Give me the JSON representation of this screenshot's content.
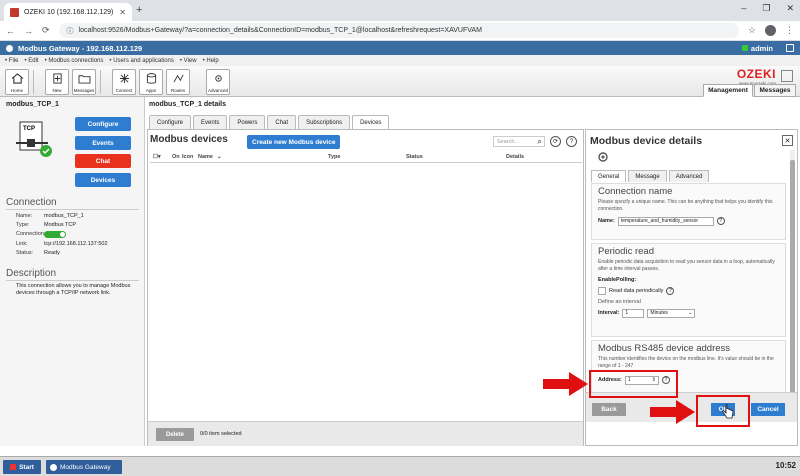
{
  "browser": {
    "tab_title": "OZEKI 10 (192.168.112.129)",
    "url": "localhost:9526/Modbus+Gateway/?a=connection_details&ConnectionID=modbus_TCP_1@localhost&refreshrequest=XAVUFVAM"
  },
  "app": {
    "title": "Modbus Gateway - 192.168.112.129",
    "user": "admin",
    "menu": [
      "File",
      "Edit",
      "Modbus connections",
      "Users and applications",
      "View",
      "Help"
    ],
    "toolbar": [
      "Home",
      "New",
      "Messages",
      "Connect",
      "Apps",
      "Routes",
      "Advanced"
    ],
    "brand": "OZEKI",
    "brand_sub": "www.myozeki.com",
    "right_tabs": [
      "Management",
      "Messages"
    ]
  },
  "left": {
    "title": "modbus_TCP_1",
    "buttons": [
      "Configure",
      "Events",
      "Chat",
      "Devices"
    ],
    "connection_title": "Connection",
    "props": [
      {
        "k": "Name:",
        "v": "modbus_TCP_1"
      },
      {
        "k": "Type:",
        "v": "Modbus TCP"
      },
      {
        "k": "Connection:",
        "v": ""
      },
      {
        "k": "Link:",
        "v": "tcp://192.168.112.137:502"
      },
      {
        "k": "Status:",
        "v": "Ready"
      }
    ],
    "description_title": "Description",
    "description": "This connection allows you to manage Modbus devices through a TCP/IP network link."
  },
  "main": {
    "title": "modbus_TCP_1 details",
    "tabs": [
      "Configure",
      "Events",
      "Powers",
      "Chat",
      "Subscriptions",
      "Devices"
    ],
    "heading": "Modbus devices",
    "new_button": "Create new Modbus device",
    "search_placeholder": "Search...",
    "columns": [
      "On",
      "Icon",
      "Name",
      "Type",
      "Status",
      "Details"
    ],
    "delete": "Delete",
    "selection": "0/0 item selected"
  },
  "details": {
    "title": "Modbus device details",
    "tabs": [
      "General",
      "Message",
      "Advanced"
    ],
    "conn_title": "Connection name",
    "conn_desc": "Please specify a unique name. This can be anything that helps you identify this connection.",
    "name_label": "Name:",
    "name_value": "temperature_and_humidity_sensor",
    "periodic_title": "Periodic read",
    "periodic_desc": "Enable periodic data acquisition to read you sensor data in a loop, automatically after a time interval passes.",
    "enable_label": "EnablePolling:",
    "checkbox_label": "Read data periodically",
    "interval_hint": "Define an interval",
    "interval_label": "Interval:",
    "interval_value": "1",
    "interval_unit": "Minutes",
    "address_title": "Modbus RS485 device address",
    "address_desc": "This number identifies the device on the modbus line. It's value should be in the range of 1 - 247",
    "address_label": "Address:",
    "address_value": "1",
    "back": "Back",
    "ok": "Ok",
    "cancel": "Cancel"
  },
  "taskbar": {
    "start": "Start",
    "item": "Modbus Gateway",
    "clock": "10:52"
  },
  "colors": {
    "accent": "#2f7dd1",
    "header": "#3a6da1",
    "alert": "#e01010"
  }
}
